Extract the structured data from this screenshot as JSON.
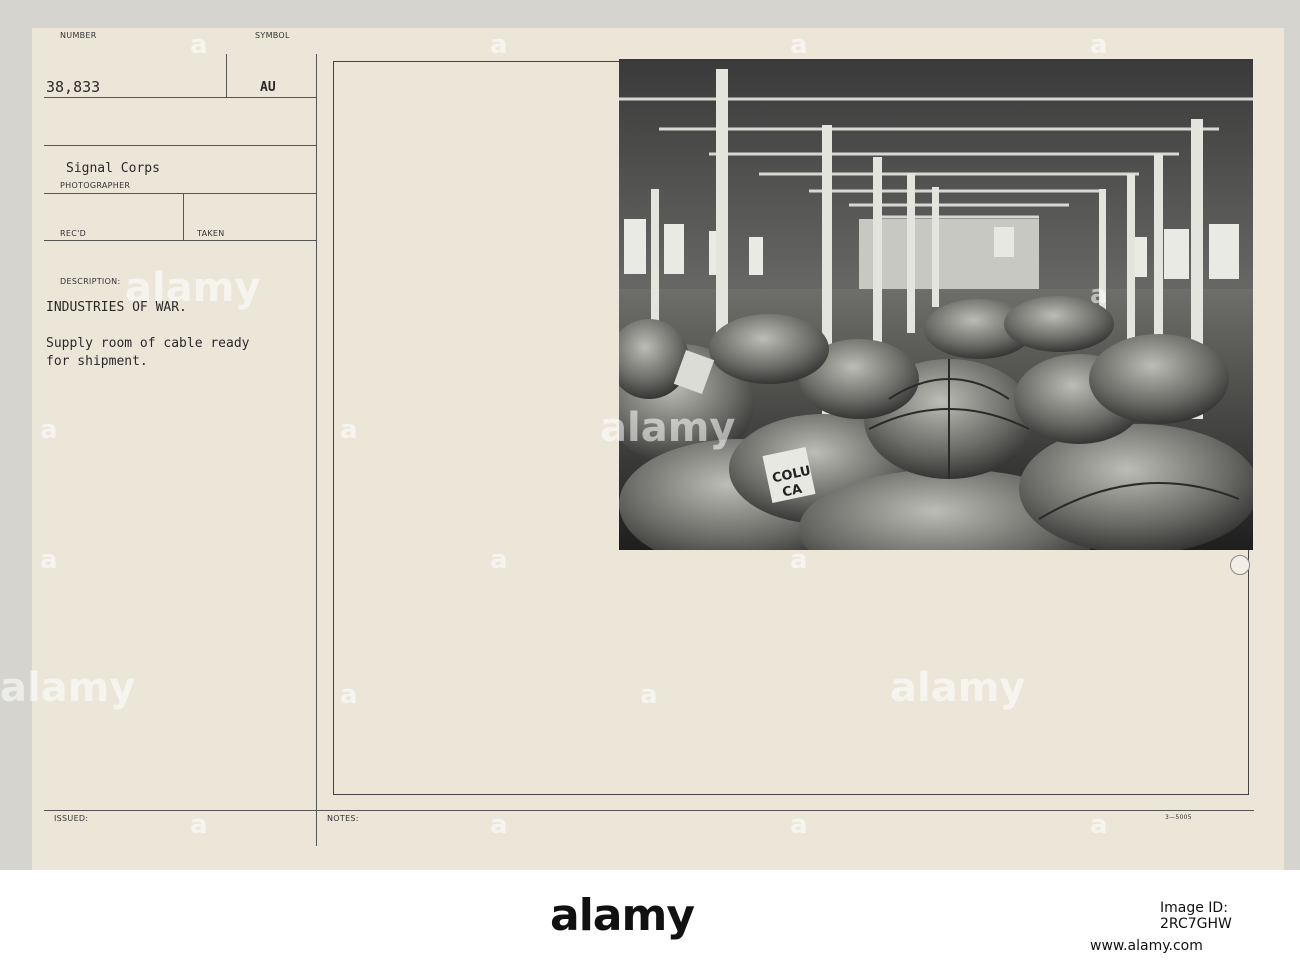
{
  "card": {
    "number_label": "NUMBER",
    "number_value": "38,833",
    "symbol_label": "SYMBOL",
    "symbol_value": "AU",
    "photographer_value": "Signal Corps",
    "photographer_label": "PHOTOGRAPHER",
    "recd_label": "REC'D",
    "taken_label": "TAKEN",
    "description_label": "DESCRIPTION:",
    "description_title": "INDUSTRIES OF WAR.",
    "description_line1": "Supply room of cable ready",
    "description_line2": "for shipment.",
    "issued_label": "ISSUED:",
    "notes_label": "NOTES:",
    "form_code": "3—5005"
  },
  "photo": {
    "label_text_1": "COLU",
    "label_text_2": "CA"
  },
  "watermark": {
    "text": "alamy",
    "letter": "a"
  },
  "footer": {
    "brand": "alamy",
    "image_id": "Image ID: 2RC7GHW",
    "site": "www.alamy.com"
  }
}
